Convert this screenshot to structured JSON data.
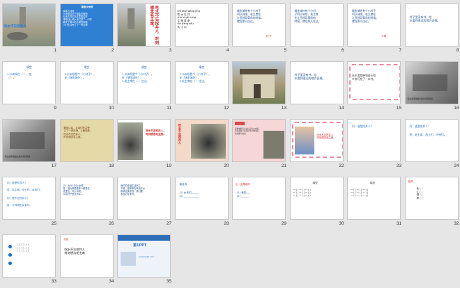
{
  "slides": [
    {
      "n": "1",
      "kind": "photo-title",
      "title": "吃水不忘挖井人"
    },
    {
      "n": "2",
      "kind": "blue-text",
      "heading": "瑞金沙洲坝",
      "text": "瑞金沙洲坝\n沙洲坝村位于瑞金市城西\n毛泽东同志在这里居住时\n带领战士和乡亲们挖了一口井\n解决了群众吃水难的问题\n人们在井旁立了一块石碑"
    },
    {
      "n": "3",
      "kind": "photo-vertical",
      "text": "吃水不忘挖井人，时刻想念毛主席。"
    },
    {
      "n": "4",
      "kind": "pinyin-words",
      "text": "chī shuǐ wàng jǐng\n吃  水  忘  井\nzhǔ xí  gé mìng\n主  席  革  命\nduì  jiāng  kǒu\n队  江  口"
    },
    {
      "n": "5",
      "kind": "text",
      "text": "瑞金城外有个小村子\n叫沙洲坝。毛主席在\n江西领导革命的时候，\n就在那儿住过。",
      "tag": "村子"
    },
    {
      "n": "6",
      "kind": "text",
      "text": "瑞金城外有个小村\n子叫沙洲坝。毛主席\n在江西领导革命的\n时候，就在那儿住过。",
      "tag": ""
    },
    {
      "n": "7",
      "kind": "text",
      "text": "瑞金城外有个小村子\n叫沙洲坝。毛主席在\n江西领导革命的时候，\n就在那儿住过。",
      "tag": "人物"
    },
    {
      "n": "8",
      "kind": "plain",
      "text": "村子里没有井，吃\n水要到很远的地方去挑。"
    },
    {
      "n": "9",
      "kind": "blue-q",
      "heading": "填空",
      "text": "1.沙洲坝在（   ），在\n（    ）。"
    },
    {
      "n": "10",
      "kind": "blue-q",
      "heading": "填空",
      "text": "1.沙洲坝是个（小村子），\n在（瑞金城外）。"
    },
    {
      "n": "11",
      "kind": "blue-q",
      "heading": "填空",
      "text": "1.沙洲坝是个（小村子），\n在（瑞金城外）。\n2.毛主席在（    ）住过。"
    },
    {
      "n": "12",
      "kind": "blue-q",
      "heading": "填空",
      "text": "1.沙洲坝是个（小村子），\n在（瑞金城外）。\n2.毛主席在（    ）住过。"
    },
    {
      "n": "13",
      "kind": "photo-house",
      "text": ""
    },
    {
      "n": "14",
      "kind": "plain",
      "text": "村子里没有井，吃\n水要到很远的地方去挑。"
    },
    {
      "n": "15",
      "kind": "pink",
      "text": "毛主席就带领战士和\n乡亲们挖了一口井。"
    },
    {
      "n": "16",
      "kind": "bw-photo",
      "text": "毛主席带领战士和乡亲们挖井"
    },
    {
      "n": "17",
      "kind": "bw-photo",
      "text": "毛主席带领战士和乡亲们挖井"
    },
    {
      "n": "18",
      "kind": "parchment",
      "text": "解放以后，乡亲们在井旁\n立了一块石碑，上面刻着：\n吃水不忘挖井人，\n时刻想念毛主席。"
    },
    {
      "n": "19",
      "kind": "well-text",
      "text": "吃水不忘挖井人，\n时刻想念毛主席。"
    },
    {
      "n": "20",
      "kind": "well-vertical",
      "text": "吃水不忘挖井人"
    },
    {
      "n": "21",
      "kind": "pink-photo",
      "text": "瑞金城外有个小村子叫沙洲坝。\n毛主席在江西领导革命的时候，\n就在那儿住过。"
    },
    {
      "n": "22",
      "kind": "pink-kids",
      "text": "吃水不忘挖井人，\n时刻想念毛主席。"
    },
    {
      "n": "23",
      "kind": "blue-qa",
      "q": "问：谁是挖井人？",
      "a": ""
    },
    {
      "n": "24",
      "kind": "blue-qa",
      "q": "问：谁是挖井人？",
      "a": "答：毛主席、战士们、乡亲们。"
    },
    {
      "n": "25",
      "kind": "blue-qa2",
      "q": "问：谁是挖井人？",
      "a": "答：毛主席、战士们、乡亲们。",
      "q2": "问：谁不忘挖井人？",
      "a2": "答：沙洲坝的乡亲们。"
    },
    {
      "n": "26",
      "kind": "note",
      "text": "问：为什么叫沙洲坝？\n答：因为那里很多人都是在\n这里住，叫沙洲坝。\n以前村子里没有井…"
    },
    {
      "n": "27",
      "kind": "note",
      "text": "我们的幸福生活来之\n不易，是革命先辈用汗水\n和鲜血换来的，我们要\n永远记住他们。"
    },
    {
      "n": "28",
      "kind": "fill",
      "heading": "我会写",
      "text": "(1) 乡亲们______\n(2) ____________"
    },
    {
      "n": "29",
      "kind": "fill-red",
      "heading": "比一比再组词",
      "text": "(1) 我的___\n(2) ______"
    },
    {
      "n": "30",
      "kind": "table",
      "heading": "填空",
      "text": "一 (  ) 一 (  ) 一 (  )\n一 (  ) 一 (  ) 一 (  )\n一 (  ) 一 (  ) 一 (  )"
    },
    {
      "n": "31",
      "kind": "table",
      "heading": "填空",
      "text": "一 (  ) 一 (  ) 一 (  )\n一 (  ) 一 (  ) 一 (  )\n一 (  ) 一 (  ) 一 (  )"
    },
    {
      "n": "32",
      "kind": "list",
      "heading": "组词",
      "text": "毛 (    )\n江 (    )\n领 (    )\n导 (    )"
    },
    {
      "n": "33",
      "kind": "bullets",
      "text": "（  ）（  ）（  ）\n（  ）（  ）（  ）\n（  ）（  ）（  ）"
    },
    {
      "n": "34",
      "kind": "summary",
      "heading": "小结",
      "text": "吃水不忘挖井人\n时刻想念毛主席"
    },
    {
      "n": "35",
      "kind": "ad",
      "logo": "第1PPT",
      "text": "www.1ppt.com"
    }
  ]
}
